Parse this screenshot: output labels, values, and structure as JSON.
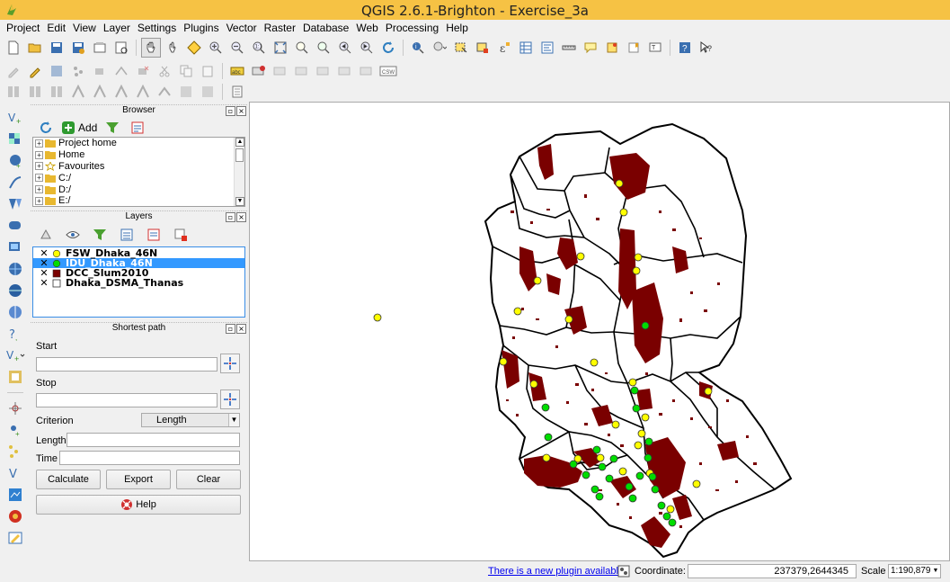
{
  "window": {
    "title": "QGIS 2.6.1-Brighton - Exercise_3a"
  },
  "menu": [
    "Project",
    "Edit",
    "View",
    "Layer",
    "Settings",
    "Plugins",
    "Vector",
    "Raster",
    "Database",
    "Web",
    "Processing",
    "Help"
  ],
  "browser_panel": {
    "title": "Browser",
    "add_label": "Add",
    "items": [
      "Project home",
      "Home",
      "Favourites",
      "C:/",
      "D:/",
      "E:/"
    ]
  },
  "layers_panel": {
    "title": "Layers",
    "layers": [
      {
        "name": "FSW_Dhaka_46N",
        "symbol": "yellow-circle",
        "color": "#ffff00",
        "checked": true,
        "selected": false
      },
      {
        "name": "IDU_Dhaka_46N",
        "symbol": "green-circle",
        "color": "#00dd00",
        "checked": true,
        "selected": true
      },
      {
        "name": "DCC_Slum2010",
        "symbol": "dark-red-square",
        "color": "#7a0000",
        "checked": true,
        "selected": false
      },
      {
        "name": "Dhaka_DSMA_Thanas",
        "symbol": "white-square",
        "color": "#ffffff",
        "checked": true,
        "selected": false
      }
    ]
  },
  "shortest_path": {
    "title": "Shortest path",
    "start_label": "Start",
    "start_value": "",
    "stop_label": "Stop",
    "stop_value": "",
    "criterion_label": "Criterion",
    "criterion_value": "Length",
    "length_label": "Length",
    "length_value": "",
    "time_label": "Time",
    "time_value": "",
    "calculate_label": "Calculate",
    "export_label": "Export",
    "clear_label": "Clear",
    "help_label": "Help"
  },
  "statusbar": {
    "plugin_notice": "There is a new plugin available",
    "coordinate_label": "Coordinate:",
    "coordinate_value": "237379,2644345",
    "scale_label": "Scale",
    "scale_value": "1:190,879"
  },
  "colors": {
    "slum_fill": "#7a0000",
    "fsw_point": "#ffff00",
    "idu_point": "#00dd00",
    "titlebar": "#f6c244",
    "selection": "#3399ff"
  }
}
